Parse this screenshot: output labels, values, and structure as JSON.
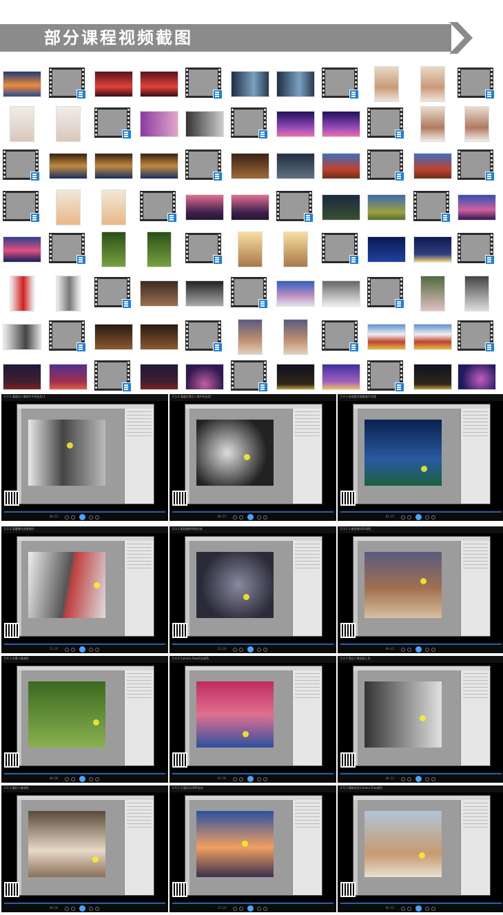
{
  "banner": {
    "title": "部分课程视频截图",
    "bar_color": "#8b8b8b",
    "arrow_color": "#8b8b8b"
  },
  "thumbnail_grid": {
    "rows": [
      [
        "photo:sunset-lake",
        "video",
        "photo:red-tree",
        "photo:red-tree",
        "video",
        "photo:window-portrait",
        "photo:window-portrait",
        "video",
        "photo:hat-girl",
        "photo:hat-girl",
        "video"
      ],
      [
        "photo:white-dress-girl",
        "photo:white-dress-girl",
        "video",
        "photo:smiling-woman",
        "photo:bw-smiling-woman",
        "video",
        "photo:purple-sky",
        "photo:purple-sky",
        "video",
        "photo:girl-portrait",
        "photo:girl-portrait"
      ],
      [
        "video",
        "photo:church-interior",
        "photo:church-interior",
        "photo:church-interior",
        "video",
        "photo:wood-interior",
        "photo:old-man-desk",
        "photo:temple",
        "video",
        "photo:temple",
        "video"
      ],
      [
        "video",
        "photo:girl-white-top",
        "photo:girl-white-top",
        "video",
        "photo:pink-mountains",
        "photo:pink-mountains",
        "video",
        "photo:green-hills-dusk",
        "photo:green-hills",
        "video",
        "photo:blue-sunset"
      ],
      [
        "photo:pink-clouds",
        "video",
        "photo:girl-grass",
        "photo:girl-grass",
        "video",
        "photo:backlit-girl",
        "photo:backlit-girl",
        "video",
        "photo:night-sky",
        "photo:night-sky-glow",
        "video"
      ],
      [
        "photo:red-shirt-girl",
        "photo:bw-girl",
        "video",
        "photo:child-face",
        "photo:bw-child-face",
        "video",
        "photo:winter-deer",
        "photo:bw-winter-deer",
        "video",
        "photo:girl-flowers",
        "photo:bw-girl-flowers"
      ],
      [
        "photo:bw-runner",
        "video",
        "photo:boy-portrait",
        "photo:boy-portrait",
        "video",
        "photo:turban-man",
        "photo:turban-man",
        "video",
        "photo:prayer-flags",
        "photo:prayer-flags",
        "video"
      ],
      [
        "photo:palace-night",
        "photo:palace-purple",
        "video",
        "photo:palace-night",
        "photo:star-trails",
        "video",
        "photo:dome-night",
        "photo:dome-purple",
        "video",
        "photo:dome-night",
        "photo:star-swirl"
      ]
    ]
  },
  "screenshots": [
    {
      "id": "shot-1",
      "caption": "5-1-1 通道在人像修片中的应用-1",
      "time": "00:12",
      "subject": "bw-woman-portrait"
    },
    {
      "id": "shot-2",
      "caption": "5-1-2 通道在黑白人像中的应用",
      "time": "00:15",
      "subject": "bw-child-portrait"
    },
    {
      "id": "shot-3",
      "caption": "5-2-1 合成星空夜景接片处理",
      "time": "01:25",
      "subject": "panorama-night-sky"
    },
    {
      "id": "shot-4",
      "caption": "5-2-2 双重曝光效果制作",
      "time": "13:35",
      "subject": "double-exposure"
    },
    {
      "id": "shot-5",
      "caption": "5-3-1 星轨旋转特效合成",
      "time": "23:18",
      "subject": "star-swirl"
    },
    {
      "id": "shot-6",
      "caption": "5-3-2 人像质感HDR调色",
      "time": "06:42",
      "subject": "turban-man"
    },
    {
      "id": "shot-7",
      "caption": "5-4-1 外景人像调色",
      "time": "00:08",
      "subject": "girl-on-grass"
    },
    {
      "id": "shot-8",
      "caption": "5-4-2 Camera Raw风光调色",
      "time": "03:50",
      "subject": "pink-sunset-sky"
    },
    {
      "id": "shot-9",
      "caption": "5-4-3 黑白人像局部上色",
      "time": "06:12",
      "subject": "bw-smiling-woman"
    },
    {
      "id": "shot-10",
      "caption": "5-5-1 婚纱人像调色",
      "time": "09:56",
      "subject": "bride-portrait"
    },
    {
      "id": "shot-11",
      "caption": "5-5-2 日落风光HDR合成",
      "time": "17:24",
      "subject": "sunset-harbor"
    },
    {
      "id": "shot-12",
      "caption": "5-5-3 建筑风光Camera Raw调色",
      "time": "02:41",
      "subject": "forbidden-city"
    }
  ]
}
